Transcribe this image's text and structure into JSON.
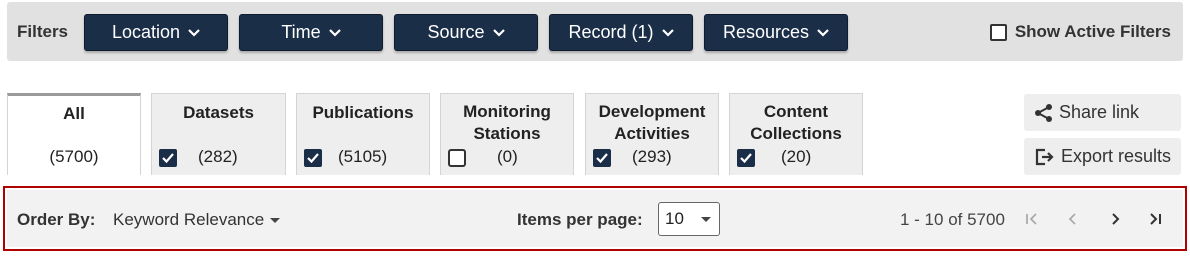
{
  "filters": {
    "label": "Filters",
    "buttons": [
      {
        "label": "Location"
      },
      {
        "label": "Time"
      },
      {
        "label": "Source"
      },
      {
        "label": "Record (1)"
      },
      {
        "label": "Resources"
      }
    ],
    "show_active_label": "Show Active Filters",
    "show_active_checked": false
  },
  "tabs": [
    {
      "title": "All",
      "count": "(5700)",
      "has_checkbox": false,
      "checked": false,
      "active": true
    },
    {
      "title": "Datasets",
      "count": "(282)",
      "has_checkbox": true,
      "checked": true,
      "active": false
    },
    {
      "title": "Publications",
      "count": "(5105)",
      "has_checkbox": true,
      "checked": true,
      "active": false
    },
    {
      "title": "Monitoring Stations",
      "count": "(0)",
      "has_checkbox": true,
      "checked": false,
      "active": false
    },
    {
      "title": "Development Activities",
      "count": "(293)",
      "has_checkbox": true,
      "checked": true,
      "active": false
    },
    {
      "title": "Content Collections",
      "count": "(20)",
      "has_checkbox": true,
      "checked": true,
      "active": false
    }
  ],
  "actions": {
    "share_label": "Share link",
    "export_label": "Export results"
  },
  "sorting": {
    "order_label": "Order By:",
    "order_value": "Keyword Relevance",
    "items_per_page_label": "Items per page:",
    "items_per_page_value": "10",
    "range_text": "1 - 10 of 5700"
  },
  "colors": {
    "filter_button_bg": "#1b2e48",
    "highlight_border": "#b00000"
  }
}
